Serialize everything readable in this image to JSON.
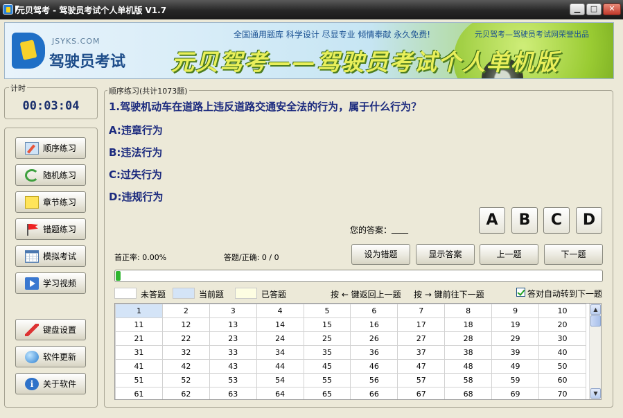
{
  "window": {
    "title": "元贝驾考 - 驾驶员考试个人单机版 V1.7",
    "minimize": "▁",
    "maximize": "□",
    "close": "✕"
  },
  "banner": {
    "site": "JSYKS.COM",
    "logo_text": "驾驶员考试",
    "slogan_top": "全国通用题库  科学设计  尽显专业  倾情奉献  永久免费!",
    "credit": "元贝驾考—驾驶员考试网荣誉出品",
    "big_title": "元贝驾考——驾驶员考试个人单机版"
  },
  "timer": {
    "label": "计时",
    "value": "00:03:04"
  },
  "nav": [
    {
      "label": "顺序练习",
      "icon": "pencil-icon"
    },
    {
      "label": "随机练习",
      "icon": "shuffle-icon"
    },
    {
      "label": "章节练习",
      "icon": "note-icon"
    },
    {
      "label": "错题练习",
      "icon": "flag-icon"
    },
    {
      "label": "模拟考试",
      "icon": "calendar-icon"
    },
    {
      "label": "学习视频",
      "icon": "video-icon"
    },
    {
      "label": "键盘设置",
      "icon": "keyboard-icon"
    },
    {
      "label": "软件更新",
      "icon": "globe-icon"
    },
    {
      "label": "关于软件",
      "icon": "info-icon"
    }
  ],
  "practice": {
    "group_label": "顺序练习(共计1073题)",
    "question": "1.驾驶机动车在道路上违反道路交通安全法的行为，属于什么行为？",
    "options": [
      "A:违章行为",
      "B:违法行为",
      "C:过失行为",
      "D:违规行为"
    ],
    "answer_label": "您的答案：",
    "answer_value": "____",
    "answer_buttons": [
      "A",
      "B",
      "C",
      "D"
    ],
    "accuracy_label": "首正率: 0.00%",
    "count_label": "答题/正确: 0 / 0",
    "actions": [
      "设为错题",
      "显示答案",
      "上一题",
      "下一题"
    ],
    "progress": 0.001,
    "legend": [
      "未答题",
      "当前题",
      "已答题"
    ],
    "hint_prev": "按 ← 键返回上一题",
    "hint_next": "按 → 键前往下一题",
    "auto_next_label": "答对自动转到下一题",
    "auto_next_checked": true
  },
  "colors": {
    "unanswered": "#ffffff",
    "current": "#d4e4f7",
    "answered": "#fdfde2",
    "progress": "#2fb52f"
  },
  "grid": [
    [
      "1",
      "2",
      "3",
      "4",
      "5",
      "6",
      "7",
      "8",
      "9",
      "10"
    ],
    [
      "11",
      "12",
      "13",
      "14",
      "15",
      "16",
      "17",
      "18",
      "19",
      "20"
    ],
    [
      "21",
      "22",
      "23",
      "24",
      "25",
      "26",
      "27",
      "28",
      "29",
      "30"
    ],
    [
      "31",
      "32",
      "33",
      "34",
      "35",
      "36",
      "37",
      "38",
      "39",
      "40"
    ],
    [
      "41",
      "42",
      "43",
      "44",
      "45",
      "46",
      "47",
      "48",
      "49",
      "50"
    ],
    [
      "51",
      "52",
      "53",
      "54",
      "55",
      "56",
      "57",
      "58",
      "59",
      "60"
    ],
    [
      "61",
      "62",
      "63",
      "64",
      "65",
      "66",
      "67",
      "68",
      "69",
      "70"
    ]
  ]
}
